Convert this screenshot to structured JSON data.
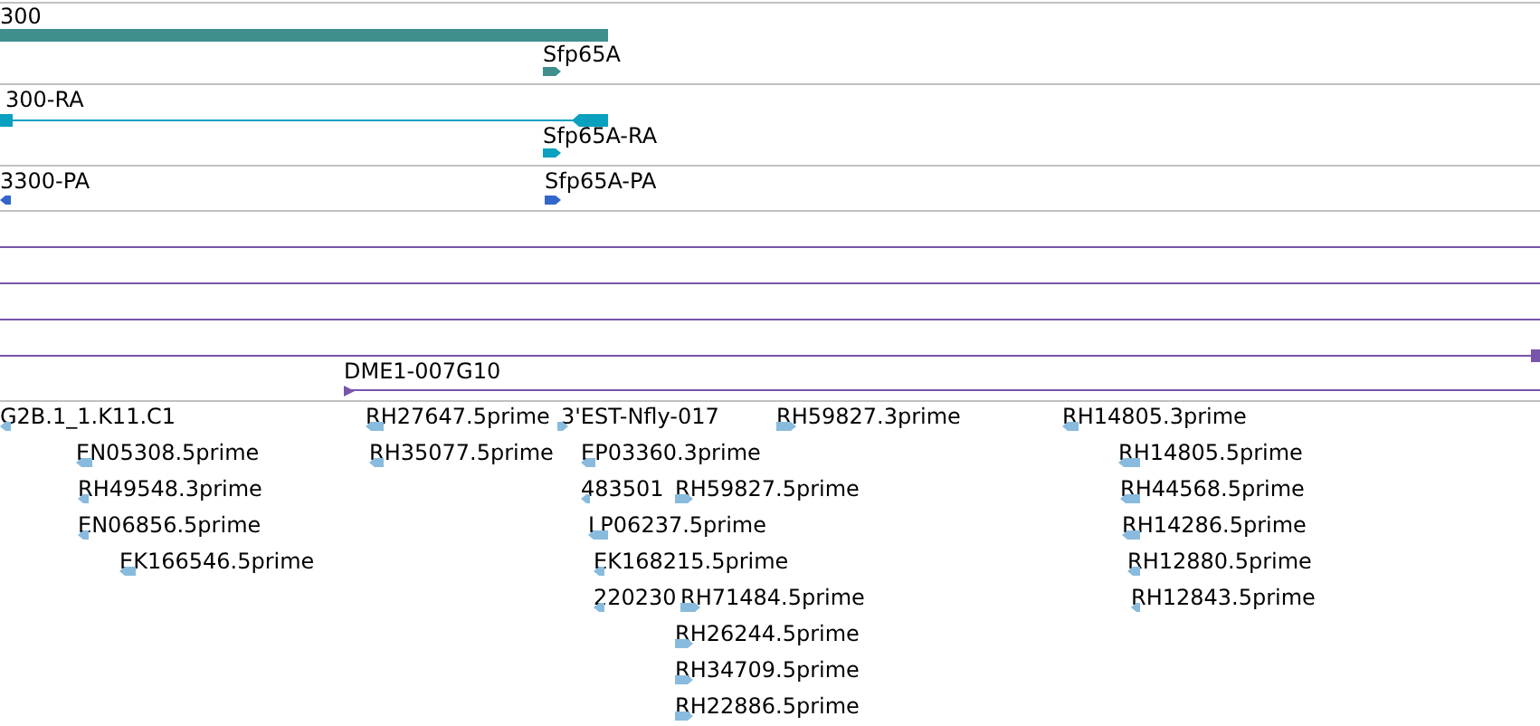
{
  "tracks": [
    {
      "kind": "gene",
      "features": [
        {
          "label": "300",
          "kind": "span"
        },
        {
          "label": "Sfp65A",
          "kind": "marker",
          "forward": true
        }
      ]
    },
    {
      "kind": "transcript",
      "features": [
        {
          "label": "300-RA",
          "kind": "span"
        },
        {
          "label": "Sfp65A-RA",
          "kind": "marker",
          "forward": true
        }
      ]
    },
    {
      "kind": "protein",
      "features": [
        {
          "label": "3300-PA",
          "kind": "marker",
          "forward": false
        },
        {
          "label": "Sfp65A-PA",
          "kind": "marker",
          "forward": true
        }
      ]
    },
    {
      "kind": "clone",
      "features": [
        {
          "label": "DME1-007G10",
          "kind": "span",
          "forward": true
        }
      ]
    },
    {
      "kind": "est",
      "features": [
        {
          "label": "G2B.1_1.K11.C1",
          "kind": "marker",
          "forward": false
        },
        {
          "label": "EN05308.5prime",
          "kind": "marker",
          "forward": false
        },
        {
          "label": "RH49548.3prime",
          "kind": "marker",
          "forward": false
        },
        {
          "label": "EN06856.5prime",
          "kind": "marker",
          "forward": false
        },
        {
          "label": "EK166546.5prime",
          "kind": "marker",
          "forward": false
        },
        {
          "label": "RH27647.5prime",
          "kind": "marker",
          "forward": false
        },
        {
          "label": "RH35077.5prime",
          "kind": "marker",
          "forward": false
        },
        {
          "label": "3'EST-Nfly-017",
          "kind": "marker",
          "forward": true
        },
        {
          "label": "EP03360.3prime",
          "kind": "marker",
          "forward": false
        },
        {
          "label": "483501",
          "kind": "marker",
          "forward": false
        },
        {
          "label": "RH59827.5prime",
          "kind": "marker",
          "forward": true
        },
        {
          "label": "LP06237.5prime",
          "kind": "marker",
          "forward": false
        },
        {
          "label": "EK168215.5prime",
          "kind": "marker",
          "forward": false
        },
        {
          "label": "220230",
          "kind": "marker",
          "forward": false
        },
        {
          "label": "RH71484.5prime",
          "kind": "marker",
          "forward": true
        },
        {
          "label": "RH26244.5prime",
          "kind": "marker",
          "forward": true
        },
        {
          "label": "RH34709.5prime",
          "kind": "marker",
          "forward": true
        },
        {
          "label": "RH22886.5prime",
          "kind": "marker",
          "forward": true
        },
        {
          "label": "RH59827.3prime",
          "kind": "marker",
          "forward": true
        },
        {
          "label": "RH14805.3prime",
          "kind": "marker",
          "forward": false
        },
        {
          "label": "RH14805.5prime",
          "kind": "marker",
          "forward": false
        },
        {
          "label": "RH44568.5prime",
          "kind": "marker",
          "forward": false
        },
        {
          "label": "RH14286.5prime",
          "kind": "marker",
          "forward": false
        },
        {
          "label": "RH12880.5prime",
          "kind": "marker",
          "forward": false
        },
        {
          "label": "RH12843.5prime",
          "kind": "marker",
          "forward": false
        }
      ]
    }
  ]
}
